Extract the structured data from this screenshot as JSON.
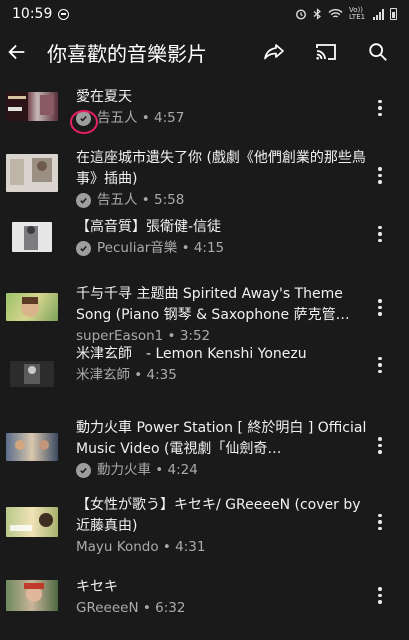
{
  "status_bar": {
    "time": "10:59",
    "network_label": "Vo)) LTE1"
  },
  "app_bar": {
    "title": "你喜歡的音樂影片",
    "back_icon": "arrow-back-icon",
    "share_icon": "share-icon",
    "cast_icon": "cast-icon",
    "search_icon": "search-icon"
  },
  "accent_colors": {
    "highlight_circle": "#e91e63",
    "background": "#1a1a1a",
    "meta_text": "#aaaaaa"
  },
  "videos": [
    {
      "title": "愛在夏天",
      "channel": "告五人",
      "verified": true,
      "duration": "4:57"
    },
    {
      "title": "在這座城市遺失了你 (戲劇《他們創業的那些鳥事》插曲)",
      "channel": "告五人",
      "verified": true,
      "duration": "5:58"
    },
    {
      "title": "【高音質】張衛健-信徒",
      "channel": "Peculiar音樂",
      "verified": true,
      "duration": "4:15"
    },
    {
      "title": "千与千寻 主题曲 Spirited Away's Theme Song (Piano 钢琴 & Saxophone 萨克管…",
      "channel": "superEason1",
      "verified": false,
      "duration": "3:52"
    },
    {
      "title": "米津玄師　- Lemon  Kenshi Yonezu",
      "channel": "米津玄師",
      "verified": false,
      "duration": "4:35"
    },
    {
      "title": "動力火車 Power Station [ 終於明白 ] Official Music Video (電視劇「仙劍奇…",
      "channel": "動力火車",
      "verified": true,
      "duration": "4:24"
    },
    {
      "title": "【女性が歌う】キセキ/ GReeeeN (cover by 近藤真由)",
      "channel": "Mayu Kondo",
      "verified": false,
      "duration": "4:31"
    },
    {
      "title": "キセキ",
      "channel": "GReeeeN",
      "verified": false,
      "duration": "6:32"
    }
  ],
  "separator": " • "
}
